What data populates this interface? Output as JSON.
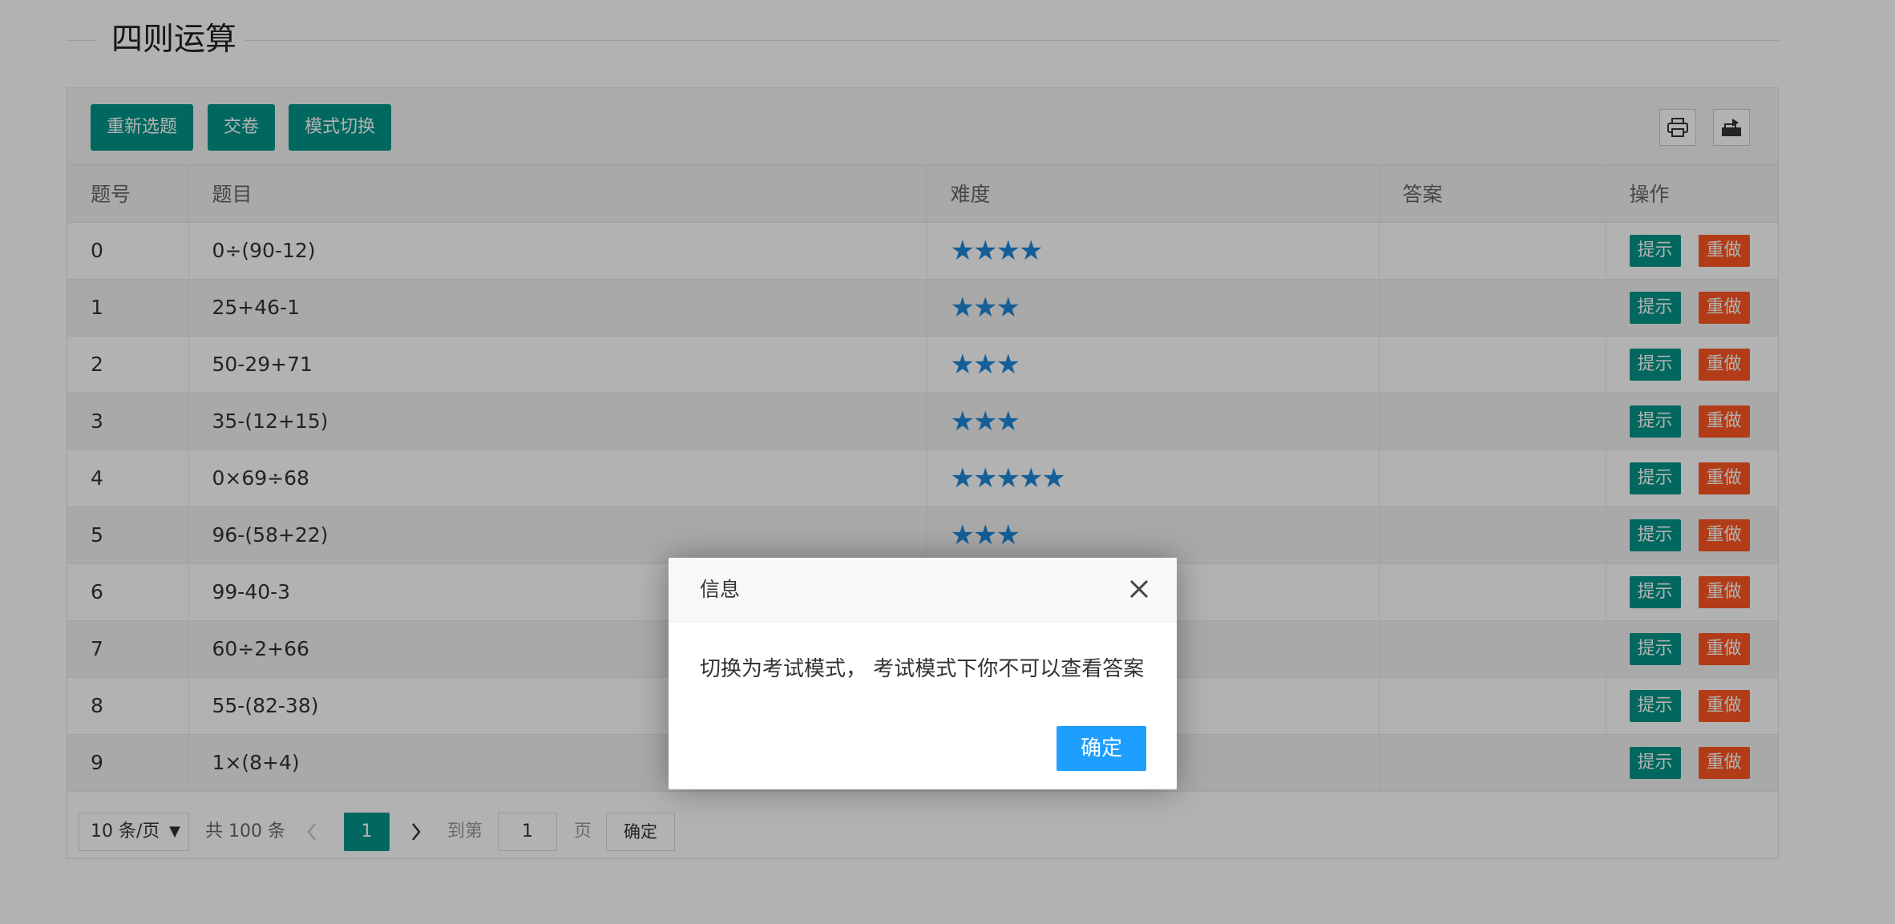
{
  "page": {
    "title": "四则运算"
  },
  "toolbar": {
    "buttons": [
      "重新选题",
      "交卷",
      "模式切换"
    ],
    "icons": [
      "print-icon",
      "export-icon"
    ]
  },
  "table": {
    "headers": [
      "题号",
      "题目",
      "难度",
      "答案",
      "操作"
    ],
    "rows": [
      {
        "id": "0",
        "question": "0÷(90-12)",
        "difficulty": 4,
        "stars": "★★★★",
        "answer": ""
      },
      {
        "id": "1",
        "question": "25+46-1",
        "difficulty": 3,
        "stars": "★★★",
        "answer": ""
      },
      {
        "id": "2",
        "question": "50-29+71",
        "difficulty": 3,
        "stars": "★★★",
        "answer": ""
      },
      {
        "id": "3",
        "question": "35-(12+15)",
        "difficulty": 3,
        "stars": "★★★",
        "answer": ""
      },
      {
        "id": "4",
        "question": "0×69÷68",
        "difficulty": 5,
        "stars": "★★★★★",
        "answer": ""
      },
      {
        "id": "5",
        "question": "96-(58+22)",
        "difficulty": 3,
        "stars": "★★★",
        "answer": ""
      },
      {
        "id": "6",
        "question": "99-40-3",
        "difficulty": 0,
        "stars": "",
        "answer": ""
      },
      {
        "id": "7",
        "question": "60÷2+66",
        "difficulty": 0,
        "stars": "",
        "answer": ""
      },
      {
        "id": "8",
        "question": "55-(82-38)",
        "difficulty": 0,
        "stars": "",
        "answer": ""
      },
      {
        "id": "9",
        "question": "1×(8+4)",
        "difficulty": 0,
        "stars": "",
        "answer": ""
      }
    ],
    "actions": {
      "hint": "提示",
      "redo": "重做"
    }
  },
  "pager": {
    "page_size": "10 条/页",
    "total": "共 100 条",
    "current": "1",
    "goto_label": "到第",
    "goto_value": "1",
    "page_suffix": "页",
    "confirm": "确定"
  },
  "dialog": {
    "title": "信息",
    "message": "切换为考试模式， 考试模式下你不可以查看答案",
    "ok": "确定"
  },
  "colors": {
    "teal": "#009688",
    "orange": "#ff5722",
    "star": "#1e88d8",
    "ok": "#1e9fff"
  }
}
